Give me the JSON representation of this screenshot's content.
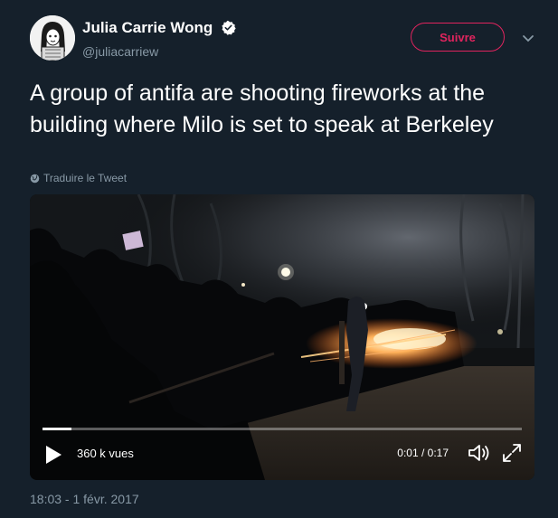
{
  "author": {
    "name": "Julia Carrie Wong",
    "handle": "@juliacarriew",
    "verified": true,
    "avatar_icon": "cartoon-portrait-avatar"
  },
  "follow_label": "Suivre",
  "tweet_text": "A group of antifa are shooting fireworks at the building where Milo is set to speak at Berkeley",
  "translate_label": "Traduire le Tweet",
  "video": {
    "views": "360 k vues",
    "time": "0:01 / 0:17",
    "progress": 0.06
  },
  "timestamp": "18:03 - 1 févr. 2017",
  "colors": {
    "background": "#15202b",
    "accent": "#e0245e",
    "secondary_text": "#8899a6",
    "verified": "#ffffff"
  }
}
